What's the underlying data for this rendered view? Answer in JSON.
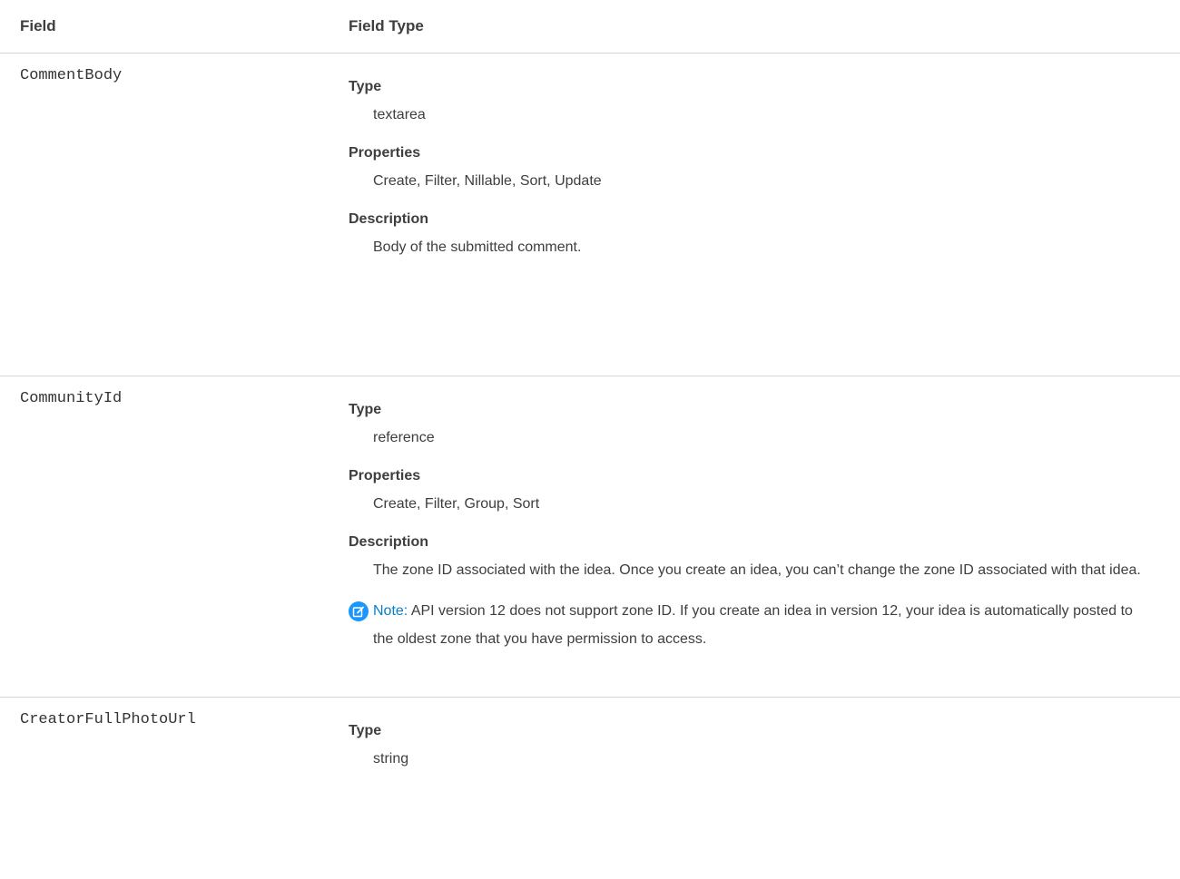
{
  "table": {
    "headers": {
      "field": "Field",
      "field_type": "Field Type"
    },
    "rows": [
      {
        "name": "CommentBody",
        "type_label": "Type",
        "type_value": "textarea",
        "properties_label": "Properties",
        "properties_value": "Create, Filter, Nillable, Sort, Update",
        "description_label": "Description",
        "description_value": "Body of the submitted comment."
      },
      {
        "name": "CommunityId",
        "type_label": "Type",
        "type_value": "reference",
        "properties_label": "Properties",
        "properties_value": "Create, Filter, Group, Sort",
        "description_label": "Description",
        "description_value": "The zone ID associated with the idea. Once you create an idea, you can’t change the zone ID associated with that idea.",
        "note_label": "Note:",
        "note_text": "API version 12 does not support zone ID. If you create an idea in version 12, your idea is automatically posted to the oldest zone that you have permission to access.",
        "note_icon": "edit-note-icon"
      },
      {
        "name": "CreatorFullPhotoUrl",
        "type_label": "Type",
        "type_value": "string"
      }
    ]
  },
  "colors": {
    "text": "#3e3e3c",
    "divider": "#d4d4d4",
    "note_icon_bg": "#1b96ff",
    "note_label": "#0b7dc9"
  }
}
